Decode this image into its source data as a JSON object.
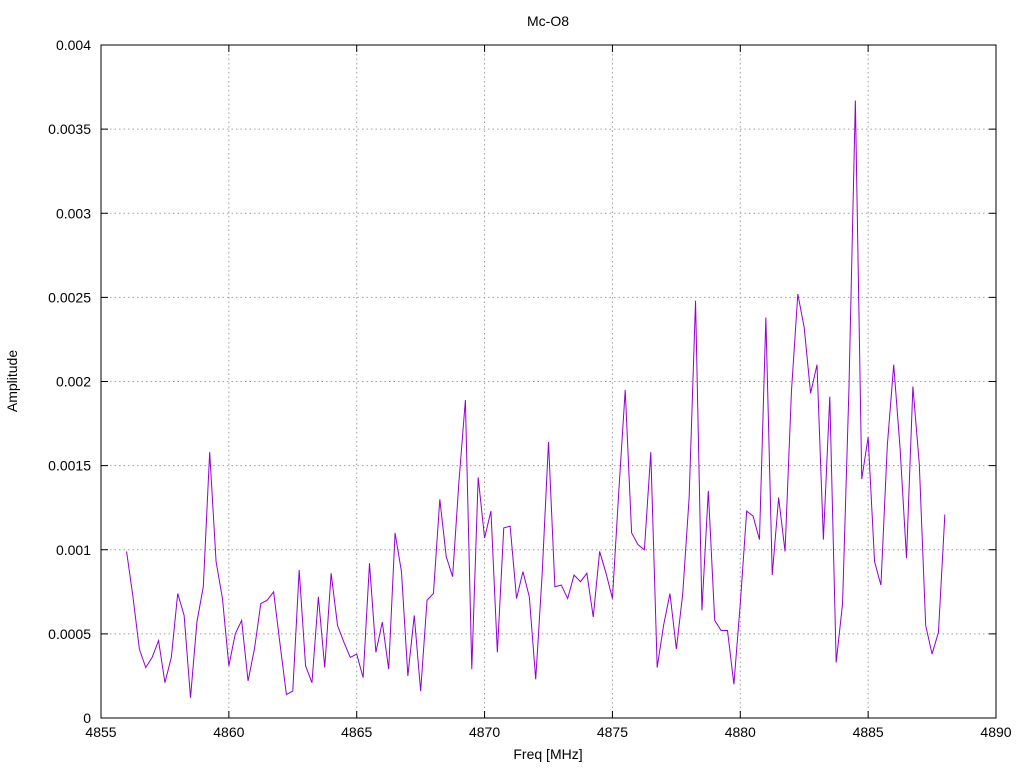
{
  "chart_data": {
    "type": "line",
    "title": "Mc-O8",
    "xlabel": "Freq [MHz]",
    "ylabel": "Amplitude",
    "xlim": [
      4855,
      4890
    ],
    "ylim": [
      0,
      0.004
    ],
    "xticks": [
      4855,
      4860,
      4865,
      4870,
      4875,
      4880,
      4885,
      4890
    ],
    "yticks": [
      0,
      0.0005,
      0.001,
      0.0015,
      0.002,
      0.0025,
      0.003,
      0.0035,
      0.004
    ],
    "xtick_labels": [
      "4855",
      "4860",
      "4865",
      "4870",
      "4875",
      "4880",
      "4885",
      "4890"
    ],
    "ytick_labels": [
      "0",
      "0.0005",
      "0.001",
      "0.0015",
      "0.002",
      "0.0025",
      "0.003",
      "0.0035",
      "0.004"
    ],
    "grid": true,
    "series": [
      {
        "color": "#9400d3",
        "x": [
          4856.0,
          4856.25,
          4856.5,
          4856.75,
          4857.0,
          4857.25,
          4857.5,
          4857.75,
          4858.0,
          4858.25,
          4858.5,
          4858.75,
          4859.0,
          4859.25,
          4859.5,
          4859.75,
          4860.0,
          4860.25,
          4860.5,
          4860.75,
          4861.0,
          4861.25,
          4861.5,
          4861.75,
          4862.0,
          4862.25,
          4862.5,
          4862.75,
          4863.0,
          4863.25,
          4863.5,
          4863.75,
          4864.0,
          4864.25,
          4864.5,
          4864.75,
          4865.0,
          4865.25,
          4865.5,
          4865.75,
          4866.0,
          4866.25,
          4866.5,
          4866.75,
          4867.0,
          4867.25,
          4867.5,
          4867.75,
          4868.0,
          4868.25,
          4868.5,
          4868.75,
          4869.0,
          4869.25,
          4869.5,
          4869.75,
          4870.0,
          4870.25,
          4870.5,
          4870.75,
          4871.0,
          4871.25,
          4871.5,
          4871.75,
          4872.0,
          4872.25,
          4872.5,
          4872.75,
          4873.0,
          4873.25,
          4873.5,
          4873.75,
          4874.0,
          4874.25,
          4874.5,
          4874.75,
          4875.0,
          4875.25,
          4875.5,
          4875.75,
          4876.0,
          4876.25,
          4876.5,
          4876.75,
          4877.0,
          4877.25,
          4877.5,
          4877.75,
          4878.0,
          4878.25,
          4878.5,
          4878.75,
          4879.0,
          4879.25,
          4879.5,
          4879.75,
          4880.0,
          4880.25,
          4880.5,
          4880.75,
          4881.0,
          4881.25,
          4881.5,
          4881.75,
          4882.0,
          4882.25,
          4882.5,
          4882.75,
          4883.0,
          4883.25,
          4883.5,
          4883.75,
          4884.0,
          4884.25,
          4884.5,
          4884.75,
          4885.0,
          4885.25,
          4885.5,
          4885.75,
          4886.0,
          4886.25,
          4886.5,
          4886.75,
          4887.0,
          4887.25,
          4887.5,
          4887.75,
          4888.0
        ],
        "y": [
          0.00099,
          0.00072,
          0.00041,
          0.0003,
          0.00036,
          0.00046,
          0.00021,
          0.00036,
          0.00074,
          0.00061,
          0.00012,
          0.00057,
          0.00078,
          0.00158,
          0.00093,
          0.00071,
          0.00031,
          0.0005,
          0.00058,
          0.00022,
          0.00041,
          0.00068,
          0.0007,
          0.00075,
          0.00044,
          0.00014,
          0.00016,
          0.00088,
          0.00031,
          0.00021,
          0.00072,
          0.0003,
          0.00086,
          0.00055,
          0.00045,
          0.00036,
          0.00038,
          0.00024,
          0.00092,
          0.00039,
          0.00057,
          0.00029,
          0.0011,
          0.00087,
          0.00025,
          0.00061,
          0.00016,
          0.0007,
          0.00074,
          0.0013,
          0.00096,
          0.00084,
          0.00141,
          0.00189,
          0.00029,
          0.00143,
          0.00107,
          0.00123,
          0.00039,
          0.00113,
          0.00114,
          0.00071,
          0.00087,
          0.00072,
          0.00023,
          0.00085,
          0.00164,
          0.00078,
          0.00079,
          0.00071,
          0.00085,
          0.00081,
          0.00086,
          0.0006,
          0.00099,
          0.00086,
          0.00071,
          0.00135,
          0.00195,
          0.0011,
          0.00103,
          0.001,
          0.00158,
          0.0003,
          0.00055,
          0.00074,
          0.00041,
          0.00074,
          0.00131,
          0.00248,
          0.00064,
          0.00135,
          0.00058,
          0.00052,
          0.00052,
          0.0002,
          0.00068,
          0.00123,
          0.0012,
          0.00106,
          0.00238,
          0.00085,
          0.00131,
          0.00099,
          0.00194,
          0.00252,
          0.00232,
          0.00193,
          0.0021,
          0.00106,
          0.00191,
          0.00033,
          0.00068,
          0.00196,
          0.00367,
          0.00142,
          0.00167,
          0.00093,
          0.00079,
          0.00162,
          0.0021,
          0.0016,
          0.00095,
          0.00197,
          0.00151,
          0.00055,
          0.00038,
          0.00051,
          0.00121
        ]
      }
    ]
  }
}
